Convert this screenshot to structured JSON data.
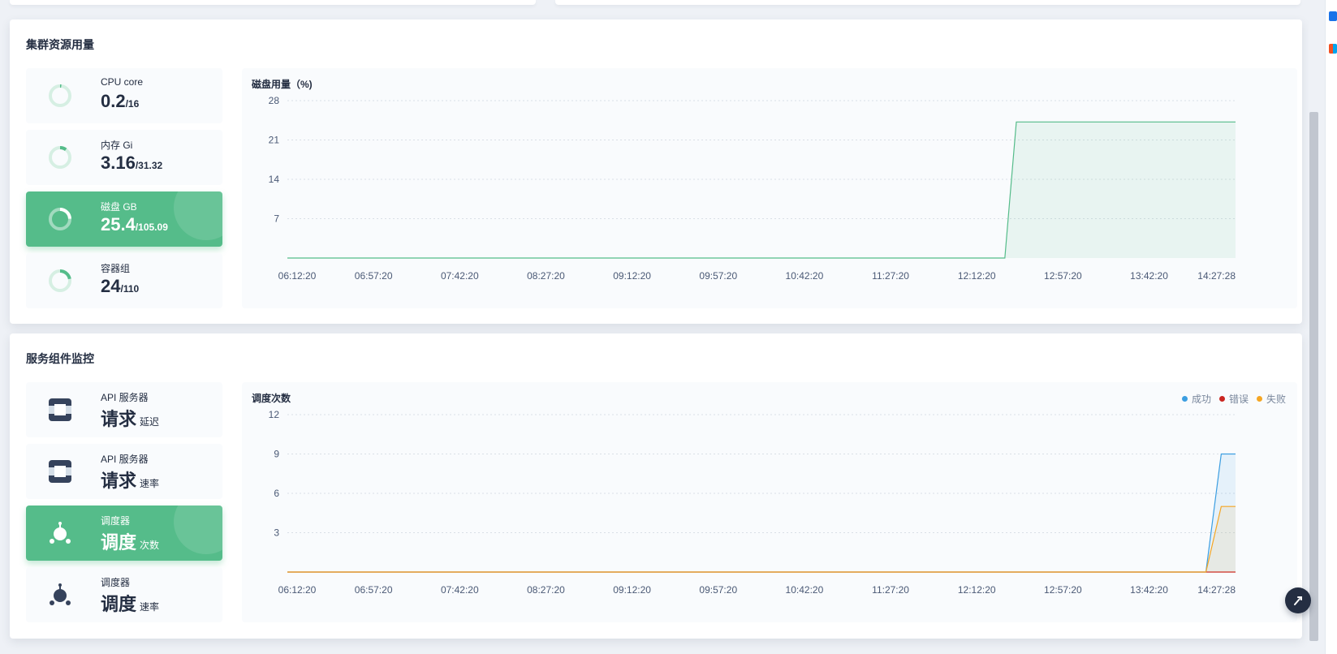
{
  "cluster": {
    "title": "集群资源用量",
    "tiles": [
      {
        "label": "CPU core",
        "value": "0.2",
        "total": "/16",
        "ratio": 0.0125,
        "active": false
      },
      {
        "label": "内存 Gi",
        "value": "3.16",
        "total": "/31.32",
        "ratio": 0.101,
        "active": false
      },
      {
        "label": "磁盘 GB",
        "value": "25.4",
        "total": "/105.09",
        "ratio": 0.242,
        "active": true
      },
      {
        "label": "容器组",
        "value": "24",
        "total": "/110",
        "ratio": 0.218,
        "active": false
      }
    ]
  },
  "services": {
    "title": "服务组件监控",
    "tiles": [
      {
        "label": "API 服务器",
        "value": "请求",
        "metric": "延迟",
        "icon": "api-server-icon",
        "active": false
      },
      {
        "label": "API 服务器",
        "value": "请求",
        "metric": "速率",
        "icon": "api-server-icon",
        "active": false
      },
      {
        "label": "调度器",
        "value": "调度",
        "metric": "次数",
        "icon": "scheduler-icon",
        "active": true
      },
      {
        "label": "调度器",
        "value": "调度",
        "metric": "速率",
        "icon": "scheduler-icon",
        "active": false
      }
    ]
  },
  "colors": {
    "accent": "#55bc8a",
    "success": "#3c9ee1",
    "error": "#ca2621",
    "fail": "#f5a623"
  },
  "chart_data": [
    {
      "type": "area",
      "title": "磁盘用量（%)",
      "x_ticks": [
        "06:12:20",
        "06:57:20",
        "07:42:20",
        "08:27:20",
        "09:12:20",
        "09:57:20",
        "10:42:20",
        "11:27:20",
        "12:12:20",
        "12:57:20",
        "13:42:20",
        "14:27:28"
      ],
      "y_ticks": [
        "7",
        "14",
        "21",
        "28"
      ],
      "ylim": [
        0,
        28
      ],
      "grid": true,
      "series": [
        {
          "points": [
            [
              "06:12:20",
              0
            ],
            [
              "12:27:00",
              0
            ],
            [
              "12:33:00",
              24.2
            ],
            [
              "14:27:28",
              24.2
            ]
          ]
        }
      ]
    },
    {
      "type": "area",
      "title": "调度次数",
      "x_ticks": [
        "06:12:20",
        "06:57:20",
        "07:42:20",
        "08:27:20",
        "09:12:20",
        "09:57:20",
        "10:42:20",
        "11:27:20",
        "12:12:20",
        "12:57:20",
        "13:42:20",
        "14:27:28"
      ],
      "y_ticks": [
        "3",
        "6",
        "9",
        "12"
      ],
      "ylim": [
        0,
        12
      ],
      "grid": true,
      "legend_position": "top-right",
      "legend": [
        "成功",
        "错误",
        "失败"
      ],
      "series": [
        {
          "name": "成功",
          "color": "#3c9ee1",
          "points": [
            [
              "06:12:20",
              0
            ],
            [
              "14:12:00",
              0
            ],
            [
              "14:20:00",
              9
            ],
            [
              "14:27:28",
              9
            ]
          ]
        },
        {
          "name": "错误",
          "color": "#ca2621",
          "points": [
            [
              "06:12:20",
              0
            ],
            [
              "14:27:28",
              0
            ]
          ]
        },
        {
          "name": "失败",
          "color": "#f5a623",
          "points": [
            [
              "06:12:20",
              0
            ],
            [
              "14:12:00",
              0
            ],
            [
              "14:20:00",
              5
            ],
            [
              "14:27:28",
              5
            ]
          ]
        }
      ]
    }
  ]
}
